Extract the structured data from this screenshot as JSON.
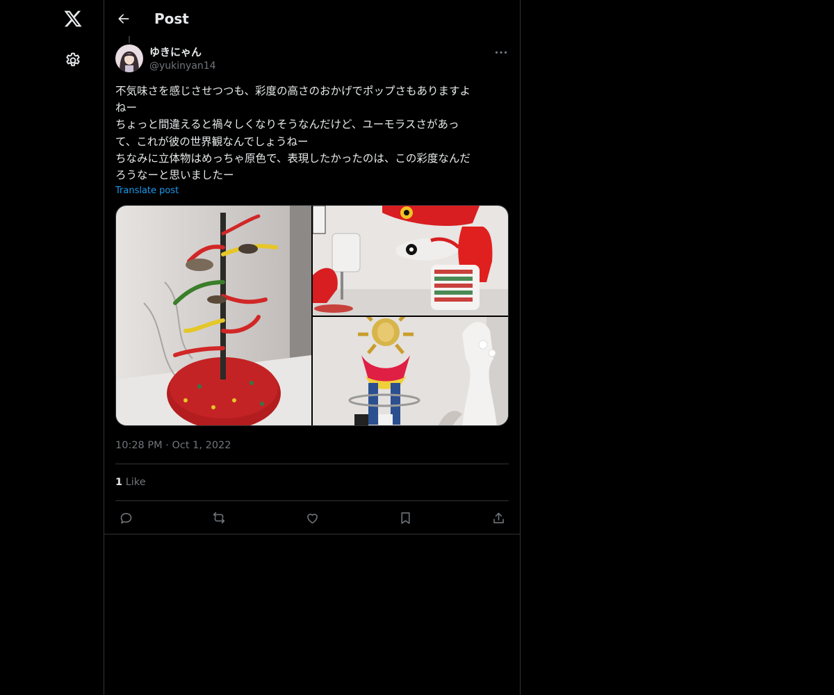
{
  "app": {
    "logo_icon": "x-logo-icon",
    "settings_icon": "gear-icon"
  },
  "header": {
    "title": "Post",
    "back_icon": "arrow-left-icon"
  },
  "post": {
    "author": {
      "display_name": "ゆきにゃん",
      "handle": "@yukinyan14"
    },
    "text_lines": [
      "不気味さを感じさせつつも、彩度の高さのおかげでポップさもありますよ",
      "ねー",
      "ちょっと間違えると禍々しくなりそうなんだけど、ユーモラスさがあっ",
      "て、これが彼の世界観なんでしょうねー",
      "ちなみに立体物はめっちゃ原色で、表現したかったのは、この彩度なんだ",
      "ろうなーと思いましたー"
    ],
    "translate_label": "Translate post",
    "timestamp": {
      "time": "10:28 PM",
      "separator": "·",
      "date": "Oct 1, 2022"
    },
    "stats": {
      "likes_count": "1",
      "likes_label": "Like"
    },
    "actions": [
      "reply-icon",
      "repost-icon",
      "like-icon",
      "bookmark-icon",
      "share-icon"
    ]
  },
  "colors": {
    "background": "#000000",
    "text": "#e7e9ea",
    "muted": "#71767b",
    "link": "#1d9bf0",
    "border": "#2f3336"
  }
}
